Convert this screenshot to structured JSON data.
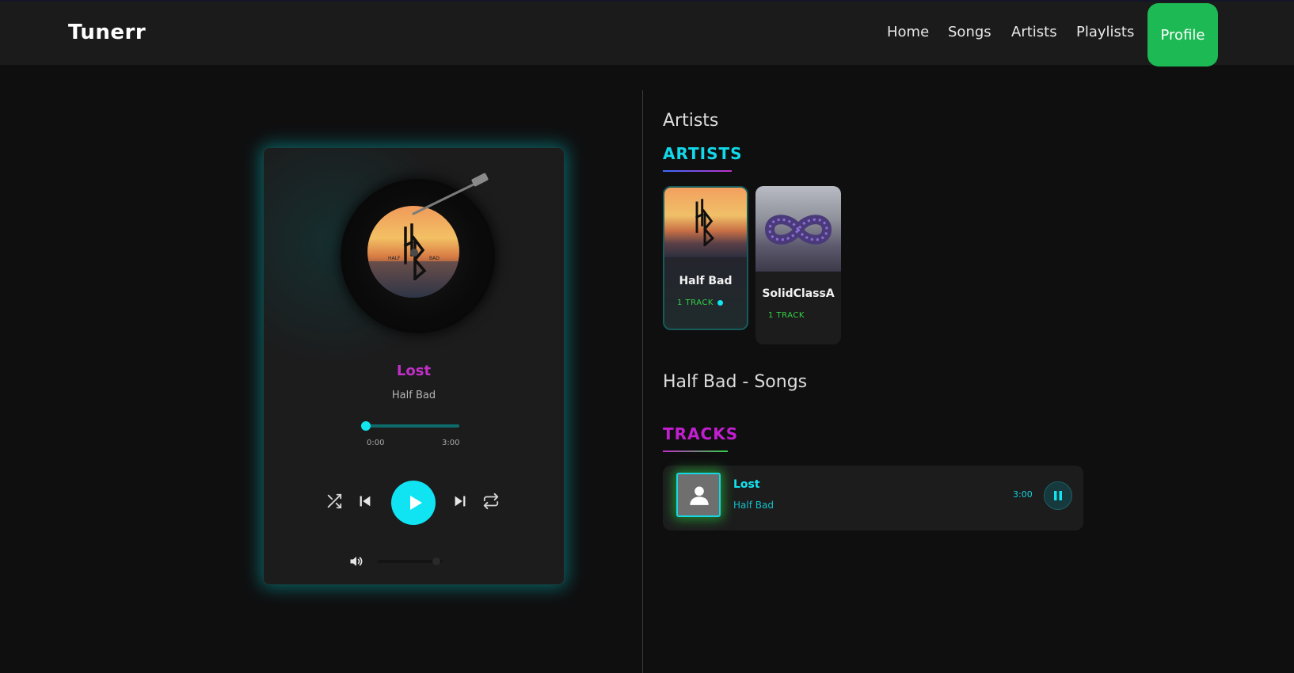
{
  "app": {
    "brand": "Tunerr"
  },
  "nav": {
    "links": [
      "Home",
      "Songs",
      "Artists",
      "Playlists"
    ],
    "profile_label": "Profile"
  },
  "player": {
    "song_title": "Lost",
    "song_artist": "Half Bad",
    "time_current": "0:00",
    "time_total": "3:00",
    "progress_fraction": 0.0,
    "volume_fraction": 0.9,
    "cover_text_left": "HALF",
    "cover_text_right": "BAD"
  },
  "artists_section": {
    "heading": "Artists",
    "badge": "ARTISTS",
    "items": [
      {
        "name": "Half Bad",
        "count": "1 TRACK",
        "active": true
      },
      {
        "name": "SolidClassA",
        "count": "1 TRACK",
        "active": false
      }
    ]
  },
  "songs_section": {
    "heading": "Half Bad - Songs",
    "badge": "TRACKS",
    "tracks": [
      {
        "title": "Lost",
        "artist": "Half Bad",
        "duration": "3:00"
      }
    ]
  },
  "colors": {
    "accent_cyan": "#12e5f0",
    "accent_magenta": "#c12fc8",
    "accent_green": "#1db954",
    "background": "#0f0f10"
  },
  "icons": {
    "shuffle": "shuffle-icon",
    "previous": "skip-previous-icon",
    "play": "play-icon",
    "next": "skip-next-icon",
    "repeat": "repeat-icon",
    "volume": "volume-icon",
    "pause": "pause-icon",
    "user": "user-icon"
  }
}
